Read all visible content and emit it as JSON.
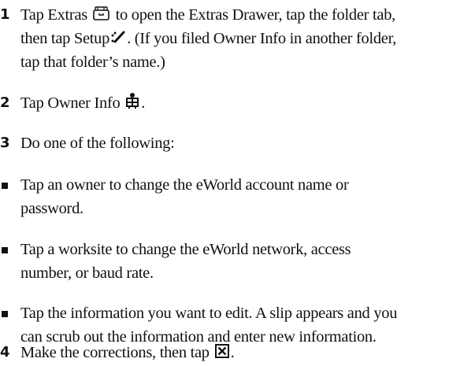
{
  "steps": [
    {
      "number": "1",
      "text_a": "Tap Extras",
      "text_b": "to open the Extras Drawer, tap the folder tab,",
      "text_c": "then tap Setup",
      "text_d": ". (If you filed Owner Info in another folder,",
      "text_e": "tap that folder’s name.)",
      "icons": [
        "extras-drawer-icon",
        "setup-icon"
      ]
    },
    {
      "number": "2",
      "text_a": "Tap Owner Info",
      "text_b": ".",
      "icons": [
        "owner-info-icon"
      ]
    },
    {
      "number": "3",
      "text_a": "Do one of the following:"
    },
    {
      "number": "4",
      "text_a": "Make the corrections, then tap",
      "text_b": ".",
      "icons": [
        "close-box-icon"
      ]
    }
  ],
  "bullets": [
    {
      "line1": "Tap an owner to change the eWorld account name or",
      "line2": "password."
    },
    {
      "line1": "Tap a worksite to change the eWorld network, access",
      "line2": "number, or baud rate."
    },
    {
      "line1": "Tap the information you want to edit. A slip appears and you",
      "line2": "can scrub out the information and enter new information."
    }
  ]
}
